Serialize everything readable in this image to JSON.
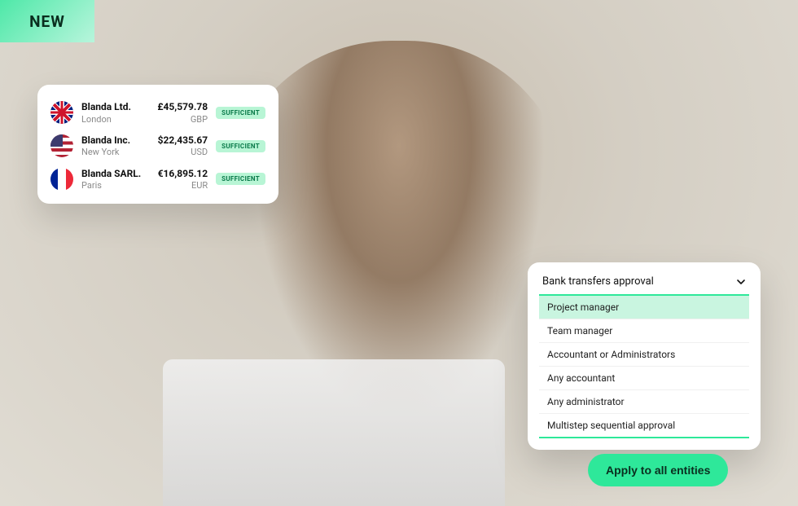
{
  "badge": {
    "label": "NEW"
  },
  "entities": [
    {
      "name": "Blanda Ltd.",
      "city": "London",
      "amount": "£45,579.78",
      "currency": "GBP",
      "status": "SUFFICIENT",
      "flag": "uk"
    },
    {
      "name": "Blanda Inc.",
      "city": "New York",
      "amount": "$22,435.67",
      "currency": "USD",
      "status": "SUFFICIENT",
      "flag": "us"
    },
    {
      "name": "Blanda SARL.",
      "city": "Paris",
      "amount": "€16,895.12",
      "currency": "EUR",
      "status": "SUFFICIENT",
      "flag": "fr"
    }
  ],
  "dropdown": {
    "label": "Bank transfers approval",
    "options": [
      {
        "label": "Project manager",
        "selected": true
      },
      {
        "label": "Team manager",
        "selected": false
      },
      {
        "label": "Accountant or Administrators",
        "selected": false
      },
      {
        "label": "Any accountant",
        "selected": false
      },
      {
        "label": "Any administrator",
        "selected": false
      },
      {
        "label": "Multistep sequential approval",
        "selected": false
      }
    ]
  },
  "actions": {
    "apply_label": "Apply to all entities"
  },
  "colors": {
    "accent": "#2ee89a",
    "accent_light": "#c9f5e0"
  }
}
